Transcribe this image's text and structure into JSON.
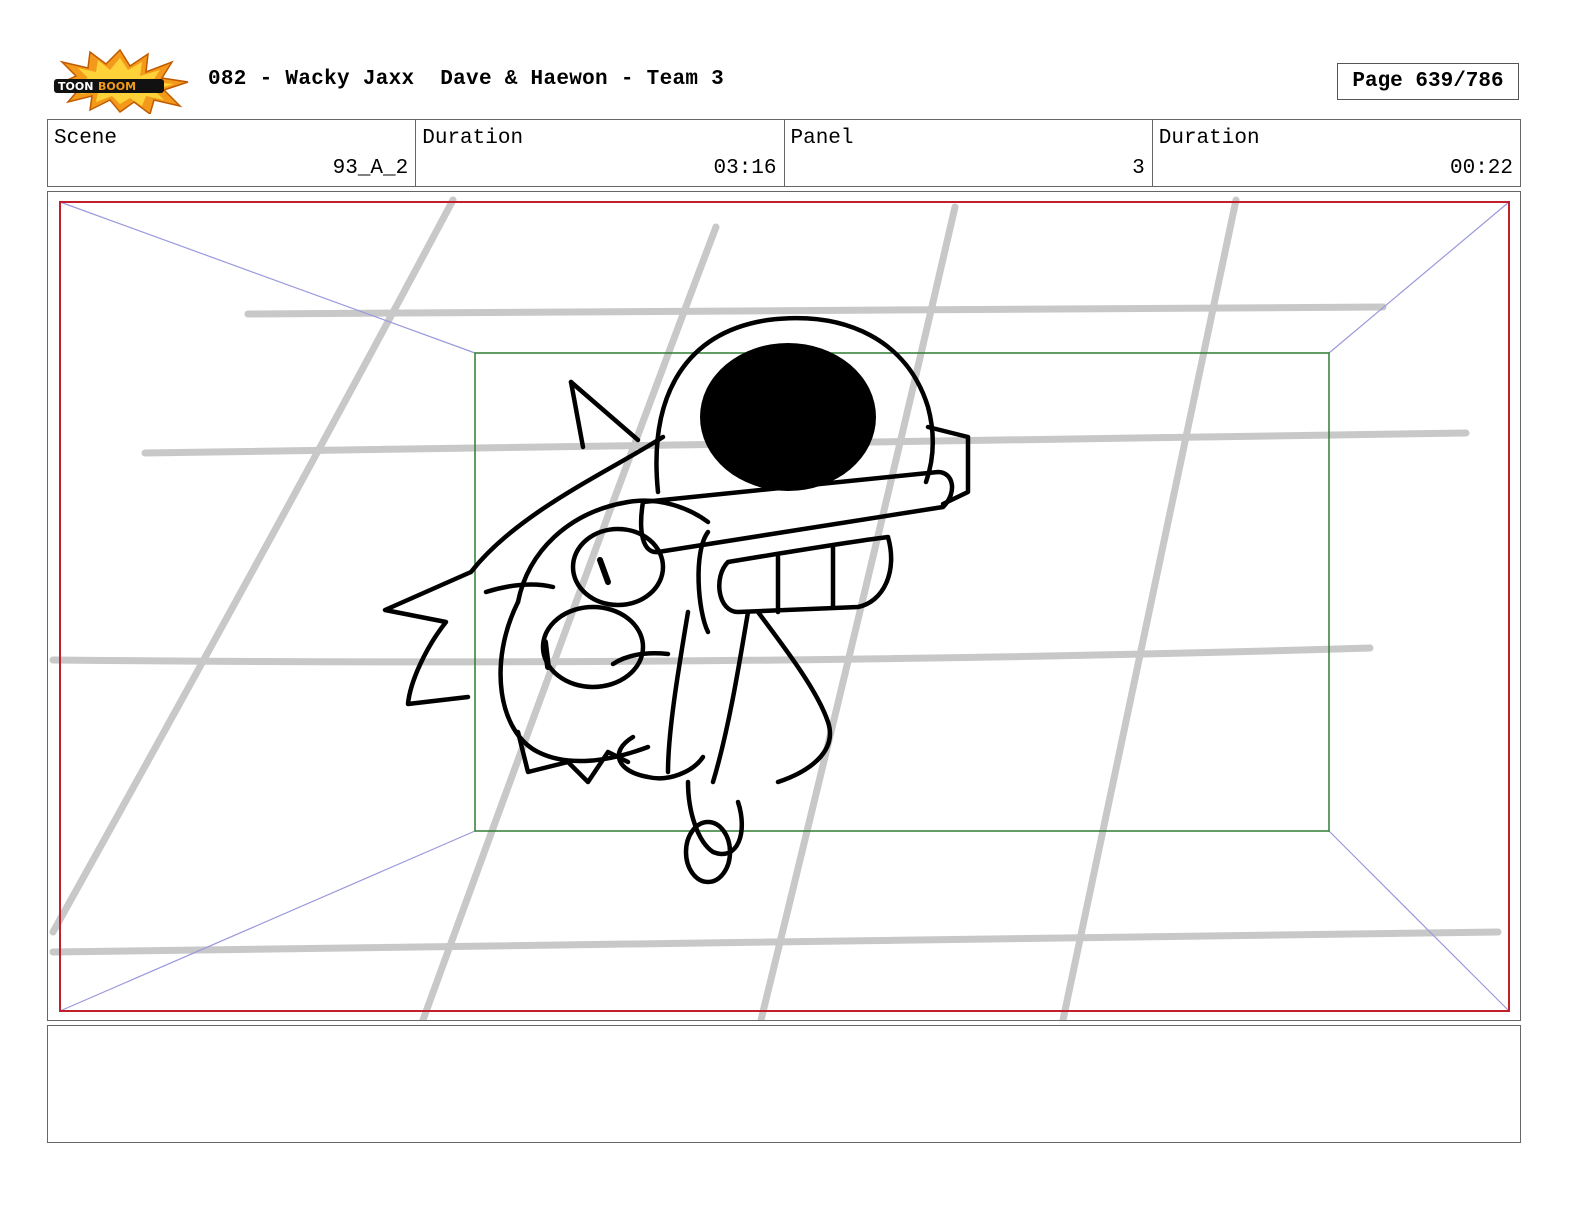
{
  "header": {
    "logo_text": "TOONBOOM",
    "title": "082 - Wacky Jaxx  Dave & Haewon - Team 3",
    "page_label": "Page 639/786"
  },
  "info": {
    "scene_label": "Scene",
    "scene_value": "93_A_2",
    "duration_label": "Duration",
    "duration_value": "03:16",
    "panel_label": "Panel",
    "panel_value": "3",
    "panel_duration_label": "Duration",
    "panel_duration_value": "00:22"
  },
  "panel": {
    "frame_color": "#c0202a",
    "safe_area_color": "#2e7d32",
    "perspective_color": "#9999dd",
    "grid_color": "#c8c8c8"
  },
  "notes": {
    "text": ""
  }
}
